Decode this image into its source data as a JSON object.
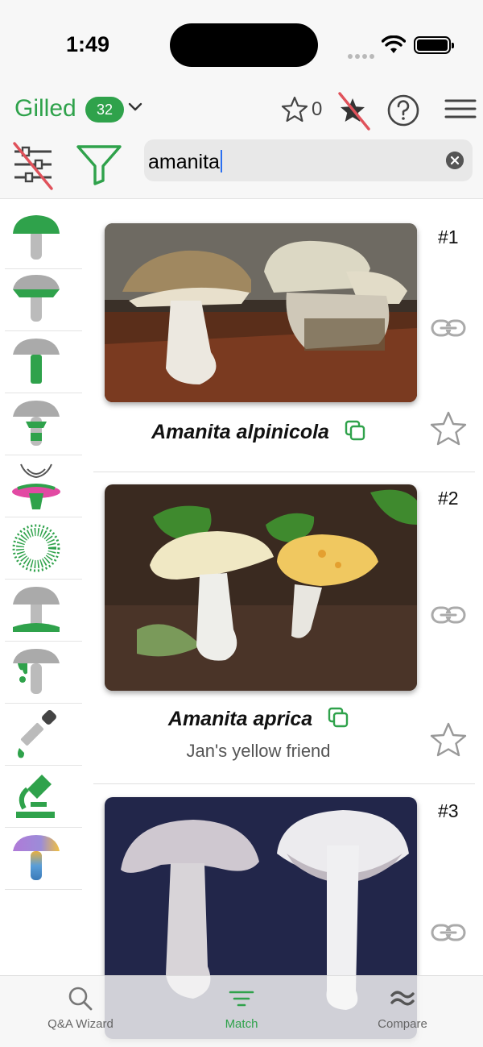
{
  "status_bar": {
    "time": "1:49"
  },
  "header": {
    "category": "Gilled",
    "category_count": "32",
    "favorites_count": "0"
  },
  "search": {
    "value": "amanita"
  },
  "traits": [
    "cap-shape",
    "gill-attachment",
    "stem-shape",
    "ring",
    "veil",
    "spore-print",
    "volva",
    "bruising",
    "chemical-test",
    "microscopy",
    "color"
  ],
  "results": [
    {
      "rank": "#1",
      "species": "Amanita alpinicola",
      "note": ""
    },
    {
      "rank": "#2",
      "species": "Amanita aprica",
      "note": "Jan's yellow friend"
    },
    {
      "rank": "#3",
      "species": "",
      "note": ""
    }
  ],
  "tabs": [
    {
      "label": "Q&A Wizard",
      "icon": "search-icon"
    },
    {
      "label": "Match",
      "icon": "filter-lines-icon"
    },
    {
      "label": "Compare",
      "icon": "approx-icon"
    }
  ],
  "colors": {
    "accent": "#2fa24b",
    "disabled_red": "#e0525b"
  }
}
